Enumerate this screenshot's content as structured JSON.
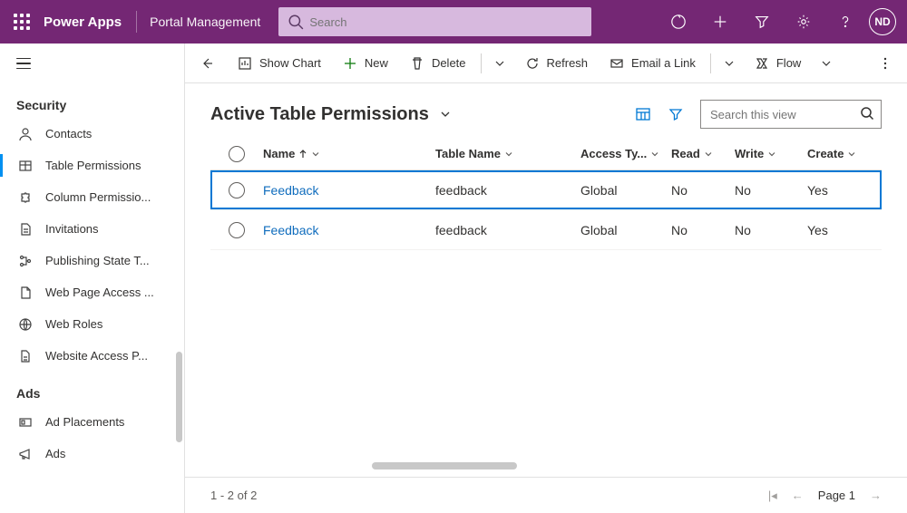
{
  "header": {
    "brand": "Power Apps",
    "app": "Portal Management",
    "search_placeholder": "Search",
    "user_initials": "ND"
  },
  "sidebar": {
    "groups": [
      {
        "title": "Security",
        "items": [
          {
            "label": "Contacts",
            "icon": "person"
          },
          {
            "label": "Table Permissions",
            "icon": "table",
            "active": true
          },
          {
            "label": "Column Permissio...",
            "icon": "puzzle"
          },
          {
            "label": "Invitations",
            "icon": "page"
          },
          {
            "label": "Publishing State T...",
            "icon": "branch"
          },
          {
            "label": "Web Page Access ...",
            "icon": "doc"
          },
          {
            "label": "Web Roles",
            "icon": "globe"
          },
          {
            "label": "Website Access P...",
            "icon": "file"
          }
        ]
      },
      {
        "title": "Ads",
        "items": [
          {
            "label": "Ad Placements",
            "icon": "placement"
          },
          {
            "label": "Ads",
            "icon": "megaphone"
          }
        ]
      }
    ]
  },
  "commandbar": {
    "show_chart": "Show Chart",
    "new": "New",
    "delete": "Delete",
    "refresh": "Refresh",
    "email": "Email a Link",
    "flow": "Flow"
  },
  "view": {
    "title": "Active Table Permissions",
    "search_placeholder": "Search this view"
  },
  "columns": {
    "name": "Name",
    "table": "Table Name",
    "access": "Access Ty...",
    "read": "Read",
    "write": "Write",
    "create": "Create"
  },
  "rows": [
    {
      "name": "Feedback",
      "table": "feedback",
      "access": "Global",
      "read": "No",
      "write": "No",
      "create": "Yes",
      "selected": true
    },
    {
      "name": "Feedback",
      "table": "feedback",
      "access": "Global",
      "read": "No",
      "write": "No",
      "create": "Yes",
      "selected": false
    }
  ],
  "footer": {
    "count": "1 - 2 of 2",
    "page": "Page 1"
  }
}
